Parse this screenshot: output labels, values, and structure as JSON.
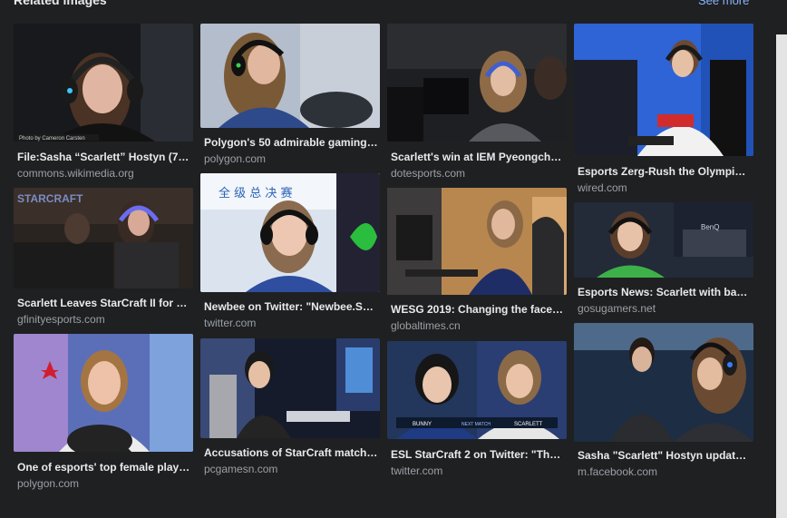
{
  "panel": {
    "title": "Related images",
    "see_more": "See more"
  },
  "colors": {
    "background": "#1f2022",
    "caption": "#e8eaed",
    "source": "#9aa0a6",
    "link": "#8ab4f8"
  },
  "columns": [
    {
      "items": [
        {
          "caption": "File:Sasha “Scarlett” Hostyn (759...",
          "source": "commons.wikimedia.org",
          "photo_credit": "Photo by Cameron Carsten"
        },
        {
          "caption": "Scarlett Leaves StarCraft II for D...",
          "source": "gfinityesports.com",
          "logo_text": "STARCRAFT"
        },
        {
          "caption": "One of esports' top female playe...",
          "source": "polygon.com"
        }
      ]
    },
    {
      "items": [
        {
          "caption": "Polygon's 50 admirable gaming p...",
          "source": "polygon.com"
        },
        {
          "caption": "Newbee on Twitter: \"Newbee.Sca...",
          "source": "twitter.com"
        },
        {
          "caption": "Accusations of StarCraft match-f...",
          "source": "pcgamesn.com"
        }
      ]
    },
    {
      "items": [
        {
          "caption": "Scarlett's win at IEM Pyeongcha...",
          "source": "dotesports.com"
        },
        {
          "caption": "WESG 2019: Changing the face o...",
          "source": "globaltimes.cn"
        },
        {
          "caption": "ESL StarCraft 2 on Twitter: \"The ...",
          "source": "twitter.com",
          "overlay": [
            "BUNNY",
            "NEXT MATCH",
            "SCARLETT"
          ]
        }
      ]
    },
    {
      "items": [
        {
          "caption": "Esports Zerg-Rush the Olympics...",
          "source": "wired.com"
        },
        {
          "caption": "Esports News: Scarlett with bac...",
          "source": "gosugamers.net",
          "logo_text": "BenQ"
        },
        {
          "caption": "Sasha \"Scarlett\" Hostyn updated...",
          "source": "m.facebook.com"
        }
      ]
    }
  ]
}
